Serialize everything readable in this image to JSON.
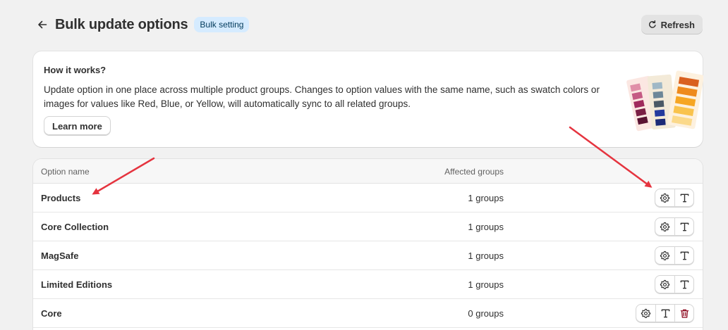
{
  "header": {
    "title": "Bulk update options",
    "badge": "Bulk setting",
    "refresh_label": "Refresh"
  },
  "info_card": {
    "title": "How it works?",
    "text": "Update option in one place across multiple product groups. Changes to option values with the same name, such as swatch colors or images for values like Red, Blue, or Yellow, will automatically sync to all related groups.",
    "button_label": "Learn more"
  },
  "table": {
    "columns": [
      "Option name",
      "Affected groups"
    ],
    "rows": [
      {
        "name": "Products",
        "groups": "1 groups"
      },
      {
        "name": "Core Collection",
        "groups": "1 groups"
      },
      {
        "name": "MagSafe",
        "groups": "1 groups"
      },
      {
        "name": "Limited Editions",
        "groups": "1 groups"
      },
      {
        "name": "Core",
        "groups": "0 groups"
      }
    ]
  },
  "icons": {
    "back": "arrow-left-icon",
    "refresh": "refresh-icon",
    "settings": "gear-icon",
    "text": "text-icon",
    "delete": "trash-icon"
  },
  "colors": {
    "badge_bg": "#d5ebff",
    "annotation_arrow": "#e5343f",
    "delete_icon": "#8e0b21"
  }
}
